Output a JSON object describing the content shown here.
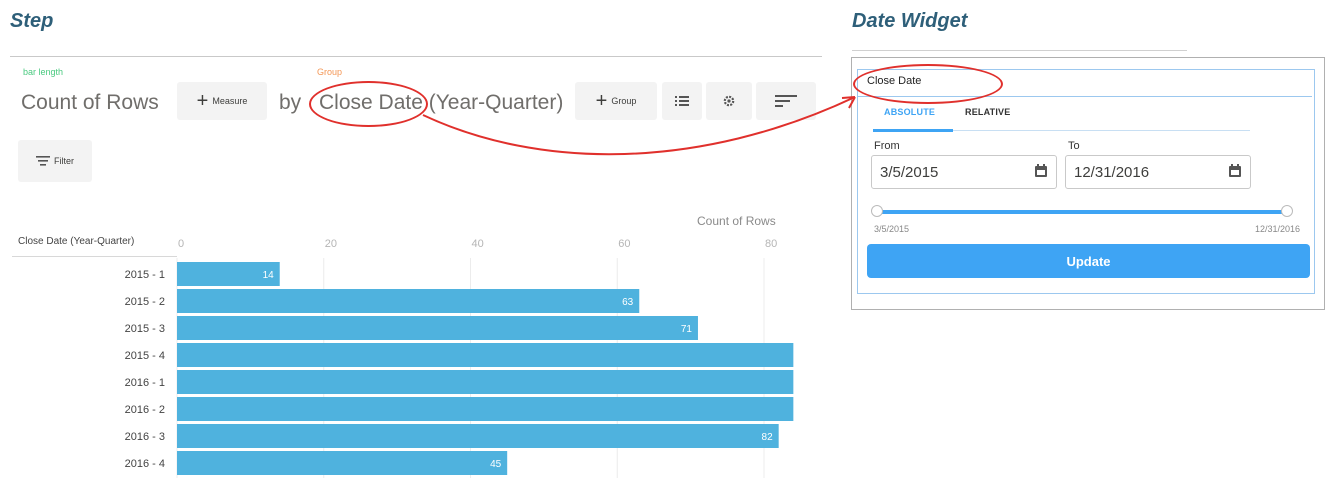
{
  "step": {
    "title": "Step",
    "measure_caption": "bar length",
    "measure_text": "Count of Rows",
    "measure_button": "Measure",
    "by_text": "by",
    "group_caption": "Group",
    "group_field": "Close Date",
    "group_suffix": "(Year-Quarter)",
    "group_button": "Group",
    "filter_button": "Filter",
    "chart_title": "Count of Rows",
    "column_header": "Close Date (Year-Quarter)"
  },
  "chart_data": {
    "type": "bar",
    "orientation": "horizontal",
    "title": "Count of Rows",
    "xlabel": "Count of Rows",
    "ylabel": "Close Date (Year-Quarter)",
    "xlim": [
      0,
      84
    ],
    "ticks": [
      0,
      20,
      40,
      60,
      80
    ],
    "categories": [
      "2015 - 1",
      "2015 - 2",
      "2015 - 3",
      "2015 - 4",
      "2016 - 1",
      "2016 - 2",
      "2016 - 3",
      "2016 - 4"
    ],
    "values": [
      14,
      63,
      71,
      84,
      84,
      84,
      82,
      45
    ],
    "data_labels": [
      "14",
      "63",
      "71",
      "",
      "",
      "",
      "82",
      "45"
    ],
    "bar_color": "#4fb2de",
    "grid": true
  },
  "date_widget": {
    "title": "Date Widget",
    "field_label": "Close Date",
    "tab_absolute": "ABSOLUTE",
    "tab_relative": "RELATIVE",
    "from_label": "From",
    "to_label": "To",
    "from_value": "3/5/2015",
    "to_value": "12/31/2016",
    "slider_min_label": "3/5/2015",
    "slider_max_label": "12/31/2016",
    "update_button": "Update",
    "accent_color": "#3ea4f4"
  },
  "colors": {
    "title": "#2e5f79",
    "caption_measure": "#4bca81",
    "caption_group": "#f49756",
    "highlight": "#e0302c"
  }
}
